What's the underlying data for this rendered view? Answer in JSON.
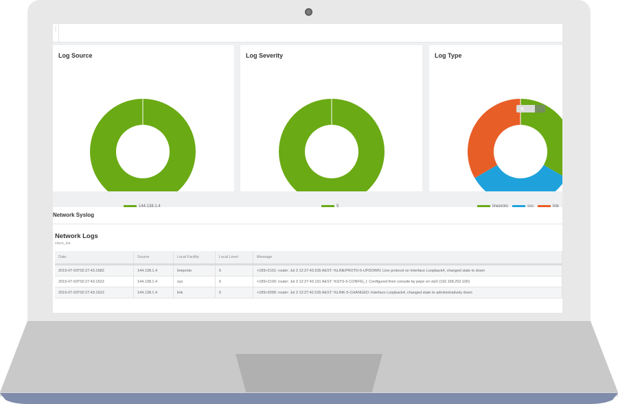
{
  "panels": {
    "source": {
      "title": "Log Source",
      "chart_data": {
        "type": "pie",
        "donut": true,
        "slices": [
          {
            "label": "144.138.1.4",
            "value": 3,
            "color": "#6aaa14"
          }
        ]
      }
    },
    "severity": {
      "title": "Log Severity",
      "chart_data": {
        "type": "pie",
        "donut": true,
        "slices": [
          {
            "label": "5",
            "value": 3,
            "color": "#6aaa14"
          }
        ]
      }
    },
    "type": {
      "title": "Log Type",
      "chart_data": {
        "type": "pie",
        "donut": true,
        "slices": [
          {
            "label": "lineproto",
            "value": 1,
            "color": "#6aaa14"
          },
          {
            "label": "sys",
            "value": 1,
            "color": "#1fa2dc"
          },
          {
            "label": "link",
            "value": 1,
            "color": "#e85e27"
          }
        ]
      }
    }
  },
  "syslog": {
    "section_title": "Network Syslog",
    "logs_title": "Network Logs",
    "logs_subtitle": "cisco_ios",
    "columns": [
      "Date",
      "Source",
      "Local Facility",
      "Local Level",
      "Message"
    ],
    "rows": [
      [
        "2019-07-03T02:27:43.168Z",
        "144.138.1.4",
        "lineproto",
        "5",
        "<189>2101: router: Jul 3 12:27:43.535 AEST: %LINEPROTO-5-UPDOWN: Line protocol on Interface Loopback4, changed state to down"
      ],
      [
        "2019-07-03T02:27:43.162Z",
        "144.138.1.4",
        "sys",
        "5",
        "<189>2100: router: Jul 3 12:27:43.191 AEST: %SYS-5-CONFIG_I: Configured from console by pepe on vty0 (192.168.252.100)"
      ],
      [
        "2019-07-03T02:27:43.162Z",
        "144.138.1.4",
        "link",
        "5",
        "<189>2099: router: Jul 3 12:27:42.535 AEST: %LINK-5-CHANGED: Interface Loopback4, changed state to administratively down"
      ]
    ]
  }
}
